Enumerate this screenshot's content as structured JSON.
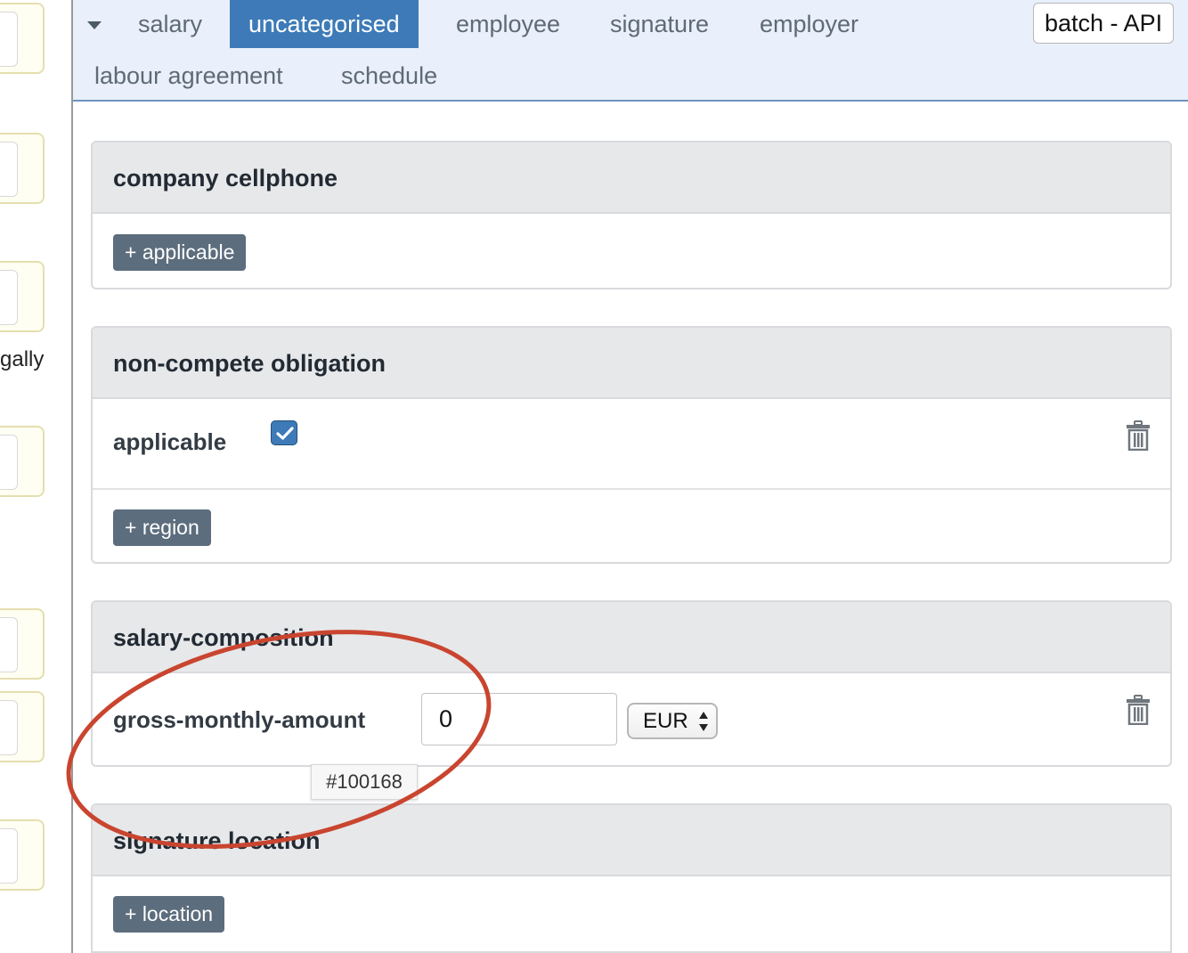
{
  "left_panel": {
    "partial_text": "gally"
  },
  "tabs": [
    {
      "label": "salary",
      "active": false
    },
    {
      "label": "uncategorised",
      "active": true
    },
    {
      "label": "employee",
      "active": false
    },
    {
      "label": "signature",
      "active": false
    },
    {
      "label": "employer",
      "active": false
    },
    {
      "label": "labour agreement",
      "active": false
    },
    {
      "label": "schedule",
      "active": false
    }
  ],
  "batch_button": {
    "label": "batch - API"
  },
  "cards": {
    "company_cellphone": {
      "title": "company cellphone",
      "add_label": "+ applicable"
    },
    "non_compete": {
      "title": "non-compete obligation",
      "field_label": "applicable",
      "checked": true,
      "add_label": "+ region"
    },
    "salary_composition": {
      "title": "salary-composition",
      "field_label": "gross-monthly-amount",
      "amount_value": "0",
      "currency": "EUR",
      "tooltip": "#100168"
    },
    "signature_location": {
      "title": "signature location",
      "add_label": "+ location"
    }
  },
  "colors": {
    "accent": "#3d7ab7",
    "annotation": "#c9452f",
    "button": "#5c6d7d",
    "tab_bar_bg": "#e9f0fb"
  },
  "icons": [
    "caret-down-icon",
    "check-icon",
    "trash-icon",
    "select-arrows-icon"
  ]
}
